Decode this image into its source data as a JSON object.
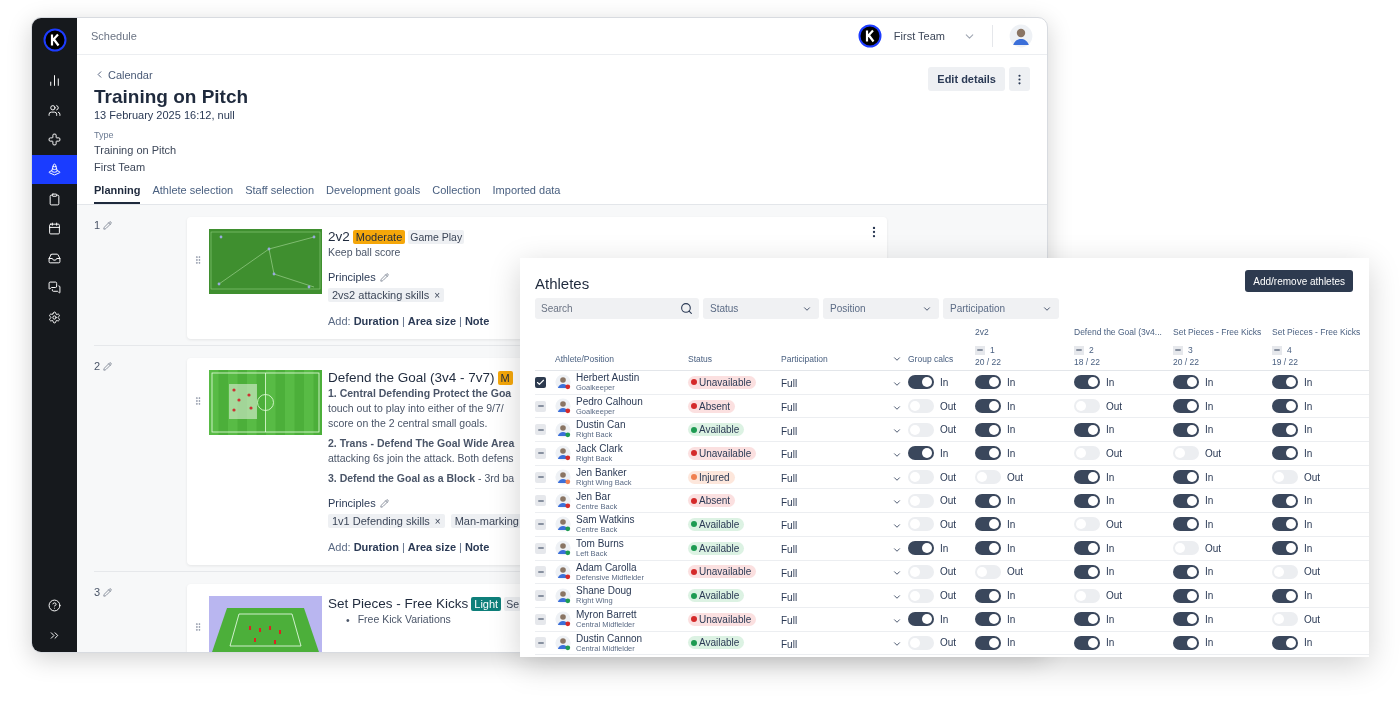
{
  "sidebar": {
    "items": [
      {
        "kind": "chart",
        "selected": false
      },
      {
        "kind": "people",
        "selected": false
      },
      {
        "kind": "medical",
        "selected": false
      },
      {
        "kind": "cone",
        "selected": true
      },
      {
        "kind": "clipboard",
        "selected": false
      },
      {
        "kind": "calendar",
        "selected": false
      },
      {
        "kind": "inbox",
        "selected": false
      },
      {
        "kind": "chat",
        "selected": false
      },
      {
        "kind": "settings",
        "selected": false
      }
    ],
    "footer": [
      {
        "kind": "help"
      },
      {
        "kind": "expand"
      }
    ]
  },
  "topbar": {
    "title": "Schedule",
    "team": "First Team"
  },
  "header": {
    "back": "Calendar",
    "title": "Training on Pitch",
    "date": "13 February 2025 16:12, null",
    "type_label": "Type",
    "type": "Training on Pitch",
    "team": "First Team",
    "edit": "Edit details"
  },
  "tabs": [
    {
      "label": "Planning",
      "selected": true
    },
    {
      "label": "Athlete selection",
      "selected": false
    },
    {
      "label": "Staff selection",
      "selected": false
    },
    {
      "label": "Development goals",
      "selected": false
    },
    {
      "label": "Collection",
      "selected": false
    },
    {
      "label": "Imported data",
      "selected": false
    }
  ],
  "drills": [
    {
      "number": "1",
      "kind": "grass",
      "title": "2v2",
      "intensity": {
        "label": "Moderate",
        "kind": "moderate"
      },
      "tags": [
        "Game Play"
      ],
      "menu": true,
      "paragraphs": [
        [
          {
            "kind": "text",
            "text": "Keep ball score"
          }
        ]
      ],
      "principles_label": "Principles",
      "principles": [
        {
          "label": "2vs2 attacking skills",
          "remove": "×"
        }
      ],
      "add": {
        "label": "Add:",
        "links": [
          "Duration",
          "Area size",
          "Note"
        ],
        "separator": "|"
      }
    },
    {
      "number": "2",
      "kind": "pitch",
      "title": "Defend the Goal (3v4 - 7v7)",
      "intensity": {
        "label": "M",
        "kind": "moderate"
      },
      "menu": false,
      "paragraphs": [
        [
          {
            "kind": "heading",
            "text": "1. Central Defending Protect the Goa"
          },
          {
            "kind": "text",
            "text": "touch out to play into either of the 9/7/"
          },
          {
            "kind": "text",
            "text": "score on the 2 central small goals."
          }
        ],
        [
          {
            "kind": "heading",
            "text": "2. Trans - Defend The Goal Wide Area"
          },
          {
            "kind": "text",
            "text": "attacking 6s join the attack. Both defens"
          }
        ],
        [
          {
            "kind": "mixed",
            "text": "**3. Defend the Goal as a Block** - 3rd ba"
          }
        ]
      ],
      "principles_label": "Principles",
      "principles": [
        {
          "label": "1v1 Defending skills",
          "remove": "×"
        },
        {
          "label": "Man-marking"
        }
      ],
      "add": {
        "label": "Add:",
        "links": [
          "Duration",
          "Area size",
          "Note"
        ],
        "separator": "|"
      }
    },
    {
      "number": "3",
      "kind": "perspective",
      "title": "Set Pieces - Free Kicks",
      "intensity": {
        "label": "Light",
        "kind": "light"
      },
      "tags": [
        "Se"
      ],
      "menu": false,
      "paragraphs": [
        [
          {
            "kind": "bullet",
            "marker": "•",
            "text": "Free Kick Variations"
          }
        ]
      ]
    }
  ],
  "athletes": {
    "title": "Athletes",
    "action": "Add/remove athletes",
    "search": {
      "placeholder": "Search"
    },
    "selects": [
      "Status",
      "Position",
      "Participation"
    ],
    "columns": {
      "athlete": "Athlete/Position",
      "status": "Status",
      "participation": "Participation",
      "group": "Group calcs"
    },
    "sessions": [
      {
        "title": "2v2",
        "number": "1",
        "count": "20 / 22"
      },
      {
        "title": "Defend the Goal (3v4...",
        "number": "2",
        "count": "18 / 22"
      },
      {
        "title": "Set Pieces - Free Kicks",
        "number": "3",
        "count": "20 / 22"
      },
      {
        "title": "Set Pieces - Free Kicks",
        "number": "4",
        "count": "19 / 22"
      }
    ],
    "rows": [
      {
        "selected": true,
        "name": "Herbert Austin",
        "position": "Goalkeeper",
        "status": {
          "label": "Unavailable",
          "kind": "unavailable"
        },
        "participation": "Full",
        "group": {
          "on": true,
          "label": "In"
        },
        "sessions": [
          {
            "on": true,
            "label": "In"
          },
          {
            "on": true,
            "label": "In"
          },
          {
            "on": true,
            "label": "In"
          },
          {
            "on": true,
            "label": "In"
          }
        ]
      },
      {
        "selected": false,
        "name": "Pedro Calhoun",
        "position": "Goalkeeper",
        "status": {
          "label": "Absent",
          "kind": "absent"
        },
        "participation": "Full",
        "group": {
          "on": false,
          "label": "Out"
        },
        "sessions": [
          {
            "on": true,
            "label": "In"
          },
          {
            "on": false,
            "label": "Out"
          },
          {
            "on": true,
            "label": "In"
          },
          {
            "on": true,
            "label": "In"
          }
        ]
      },
      {
        "selected": false,
        "name": "Dustin Can",
        "position": "Right Back",
        "status": {
          "label": "Available",
          "kind": "available"
        },
        "participation": "Full",
        "group": {
          "on": false,
          "label": "Out"
        },
        "sessions": [
          {
            "on": true,
            "label": "In"
          },
          {
            "on": true,
            "label": "In"
          },
          {
            "on": true,
            "label": "In"
          },
          {
            "on": true,
            "label": "In"
          }
        ]
      },
      {
        "selected": false,
        "name": "Jack Clark",
        "position": "Right Back",
        "status": {
          "label": "Unavailable",
          "kind": "unavailable"
        },
        "participation": "Full",
        "group": {
          "on": true,
          "label": "In"
        },
        "sessions": [
          {
            "on": true,
            "label": "In"
          },
          {
            "on": false,
            "label": "Out"
          },
          {
            "on": false,
            "label": "Out"
          },
          {
            "on": true,
            "label": "In"
          }
        ]
      },
      {
        "selected": false,
        "name": "Jen Banker",
        "position": "Right Wing Back",
        "status": {
          "label": "Injured",
          "kind": "injured"
        },
        "participation": "Full",
        "group": {
          "on": false,
          "label": "Out"
        },
        "sessions": [
          {
            "on": false,
            "label": "Out"
          },
          {
            "on": true,
            "label": "In"
          },
          {
            "on": true,
            "label": "In"
          },
          {
            "on": false,
            "label": "Out"
          }
        ]
      },
      {
        "selected": false,
        "name": "Jen Bar",
        "position": "Centre Back",
        "status": {
          "label": "Absent",
          "kind": "absent"
        },
        "participation": "Full",
        "group": {
          "on": false,
          "label": "Out"
        },
        "sessions": [
          {
            "on": true,
            "label": "In"
          },
          {
            "on": true,
            "label": "In"
          },
          {
            "on": true,
            "label": "In"
          },
          {
            "on": true,
            "label": "In"
          }
        ]
      },
      {
        "selected": false,
        "name": "Sam Watkins",
        "position": "Centre Back",
        "status": {
          "label": "Available",
          "kind": "available"
        },
        "participation": "Full",
        "group": {
          "on": false,
          "label": "Out"
        },
        "sessions": [
          {
            "on": true,
            "label": "In"
          },
          {
            "on": false,
            "label": "Out"
          },
          {
            "on": true,
            "label": "In"
          },
          {
            "on": true,
            "label": "In"
          }
        ]
      },
      {
        "selected": false,
        "name": "Tom Burns",
        "position": "Left Back",
        "status": {
          "label": "Available",
          "kind": "available"
        },
        "participation": "Full",
        "group": {
          "on": true,
          "label": "In"
        },
        "sessions": [
          {
            "on": true,
            "label": "In"
          },
          {
            "on": true,
            "label": "In"
          },
          {
            "on": false,
            "label": "Out"
          },
          {
            "on": true,
            "label": "In"
          }
        ]
      },
      {
        "selected": false,
        "name": "Adam Carolla",
        "position": "Defensive Midfielder",
        "status": {
          "label": "Unavailable",
          "kind": "unavailable"
        },
        "participation": "Full",
        "group": {
          "on": false,
          "label": "Out"
        },
        "sessions": [
          {
            "on": false,
            "label": "Out"
          },
          {
            "on": true,
            "label": "In"
          },
          {
            "on": true,
            "label": "In"
          },
          {
            "on": false,
            "label": "Out"
          }
        ]
      },
      {
        "selected": false,
        "name": "Shane Doug",
        "position": "Right Wing",
        "status": {
          "label": "Available",
          "kind": "available"
        },
        "participation": "Full",
        "group": {
          "on": false,
          "label": "Out"
        },
        "sessions": [
          {
            "on": true,
            "label": "In"
          },
          {
            "on": false,
            "label": "Out"
          },
          {
            "on": true,
            "label": "In"
          },
          {
            "on": true,
            "label": "In"
          }
        ]
      },
      {
        "selected": false,
        "name": "Myron Barrett",
        "position": "Central Midfielder",
        "status": {
          "label": "Unavailable",
          "kind": "unavailable"
        },
        "participation": "Full",
        "group": {
          "on": true,
          "label": "In"
        },
        "sessions": [
          {
            "on": true,
            "label": "In"
          },
          {
            "on": true,
            "label": "In"
          },
          {
            "on": true,
            "label": "In"
          },
          {
            "on": false,
            "label": "Out"
          }
        ]
      },
      {
        "selected": false,
        "name": "Dustin Cannon",
        "position": "Central Midfielder",
        "status": {
          "label": "Available",
          "kind": "available"
        },
        "participation": "Full",
        "group": {
          "on": false,
          "label": "Out"
        },
        "sessions": [
          {
            "on": true,
            "label": "In"
          },
          {
            "on": true,
            "label": "In"
          },
          {
            "on": true,
            "label": "In"
          },
          {
            "on": true,
            "label": "In"
          }
        ]
      }
    ]
  }
}
